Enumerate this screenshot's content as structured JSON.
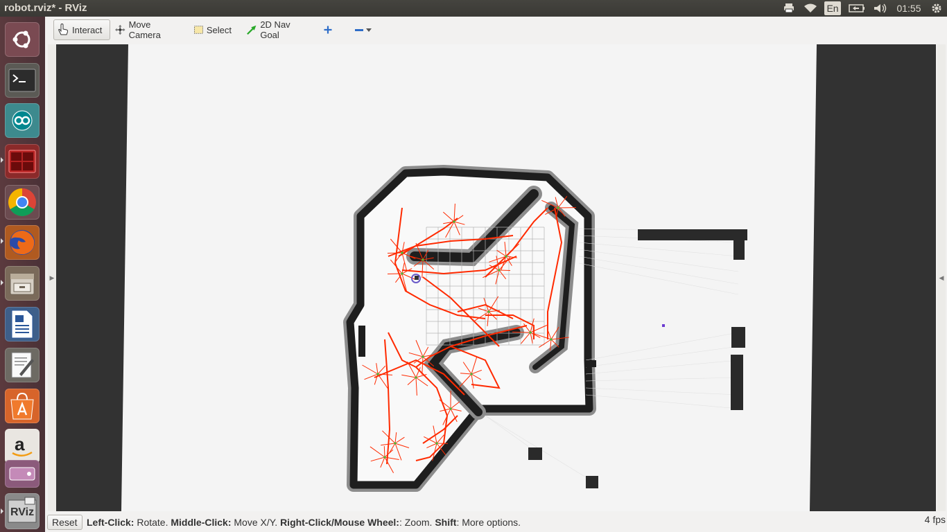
{
  "window": {
    "title": "robot.rviz* - RViz"
  },
  "panel": {
    "language": "En",
    "clock": "01:55",
    "icons": [
      "printer-icon",
      "wifi-icon",
      "keyboard-layout-icon",
      "battery-icon",
      "volume-icon",
      "gear-icon"
    ]
  },
  "launcher": {
    "items": [
      {
        "name": "ubuntu-dash",
        "icon": "ubuntu-logo-icon"
      },
      {
        "name": "terminal",
        "icon": "terminal-icon"
      },
      {
        "name": "arduino",
        "icon": "arduino-icon"
      },
      {
        "name": "workspace-terminals",
        "icon": "terminal-red-icon"
      },
      {
        "name": "chrome",
        "icon": "chrome-icon"
      },
      {
        "name": "firefox",
        "icon": "firefox-icon"
      },
      {
        "name": "files",
        "icon": "file-cabinet-icon"
      },
      {
        "name": "libreoffice-writer",
        "icon": "writer-document-icon"
      },
      {
        "name": "text-editor",
        "icon": "text-editor-icon"
      },
      {
        "name": "software-center",
        "icon": "shopping-bag-icon"
      },
      {
        "name": "amazon",
        "icon": "amazon-icon"
      },
      {
        "name": "rviz",
        "icon": "rviz-icon"
      }
    ]
  },
  "toolbar": {
    "interact": "Interact",
    "move_camera": "Move Camera",
    "select": "Select",
    "nav_goal": "2D Nav Goal",
    "add_tool_icon": "plus-icon",
    "remove_tool_icon": "minus-icon"
  },
  "statusbar": {
    "reset": "Reset",
    "left_click_key": "Left-Click:",
    "left_click_action": " Rotate. ",
    "middle_click_key": "Middle-Click:",
    "middle_click_action": " Move X/Y. ",
    "right_click_key": "Right-Click/Mouse Wheel:",
    "right_click_action": ": Zoom. ",
    "shift_key": "Shift",
    "shift_action": ": More options.",
    "fps": "4 fps"
  },
  "colors": {
    "map_free": "#f7f7f7",
    "map_wall": "#1e1e1e",
    "map_unknown": "#323232",
    "trajectory": "#ff2a00",
    "grid": "#b4b4b4"
  }
}
